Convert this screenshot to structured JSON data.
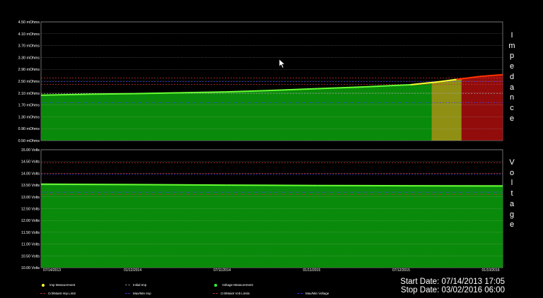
{
  "chart_data": [
    {
      "type": "area",
      "ylabel": "Impedance",
      "ylim": [
        0.5,
        4.5
      ],
      "yticks": [
        "4.50 mOhms",
        "4.10 mOhms",
        "3.70 mOhms",
        "3.30 mOhms",
        "2.90 mOhms",
        "2.50 mOhms",
        "2.10 mOhms",
        "1.70 mOhms",
        "1.30 mOhms",
        "0.90 mOhms",
        "0.50 mOhms"
      ],
      "ytick_values": [
        4.5,
        4.1,
        3.7,
        3.3,
        2.9,
        2.5,
        2.1,
        1.7,
        1.3,
        0.9,
        0.5
      ],
      "series": [
        {
          "name": "Imp Measurement",
          "x": [
            0,
            0.1,
            0.2,
            0.3,
            0.4,
            0.5,
            0.6,
            0.7,
            0.8,
            0.85,
            0.9,
            0.95,
            1.0
          ],
          "values": [
            2.03,
            2.06,
            2.08,
            2.11,
            2.14,
            2.19,
            2.25,
            2.31,
            2.38,
            2.46,
            2.56,
            2.66,
            2.72
          ]
        },
        {
          "name": "Initial Imp",
          "value": 2.09
        },
        {
          "name": "Crit/Maint Imp Limit",
          "values": [
            2.61,
            2.39
          ]
        },
        {
          "name": "Max/Min Imp",
          "values": [
            2.49,
            1.78
          ]
        }
      ],
      "zones": [
        {
          "name": "ok",
          "color": "#0a8a0a",
          "from": 0,
          "to": 0.846
        },
        {
          "name": "maintenance",
          "color": "#8f8f14",
          "from": 0.846,
          "to": 0.911
        },
        {
          "name": "critical",
          "color": "#920c0c",
          "from": 0.911,
          "to": 1.0
        }
      ]
    },
    {
      "type": "area",
      "ylabel": "Voltage",
      "ylim": [
        10.0,
        15.0
      ],
      "yticks": [
        "15.00 Volts",
        "14.50 Volts",
        "14.00 Volts",
        "13.50 Volts",
        "13.00 Volts",
        "12.50 Volts",
        "12.00 Volts",
        "11.50 Volts",
        "11.00 Volts",
        "10.50 Volts",
        "10.00 Volts"
      ],
      "ytick_values": [
        15,
        14.5,
        14,
        13.5,
        13,
        12.5,
        12,
        11.5,
        11,
        10.5,
        10
      ],
      "series": [
        {
          "name": "Voltage Measurement",
          "x": [
            0,
            0.2,
            0.4,
            0.6,
            0.8,
            1.0
          ],
          "values": [
            13.54,
            13.52,
            13.5,
            13.48,
            13.47,
            13.46
          ]
        },
        {
          "name": "Crit/Maint Volt Limits",
          "values": [
            14.45,
            14.0,
            13.1
          ]
        },
        {
          "name": "Max/Min Voltage",
          "values": [
            13.95,
            13.2
          ]
        }
      ]
    }
  ],
  "x_tick_labels": [
    "07/14/2013",
    "01/12/2014",
    "07/11/2014",
    "01/11/2015",
    "07/12/2015",
    "01/10/2016"
  ],
  "side_labels": {
    "impedance": [
      "I",
      "m",
      "p",
      "e",
      "d",
      "a",
      "n",
      "c",
      "e"
    ],
    "voltage": [
      "V",
      "o",
      "l",
      "t",
      "a",
      "g",
      "e"
    ]
  },
  "legend": [
    {
      "label": "Imp Measurement",
      "color": "#ffff33",
      "style": "dot"
    },
    {
      "label": "Initial Imp",
      "color": "#888888",
      "style": "dash"
    },
    {
      "label": "Voltage Measurement",
      "color": "#33ff33",
      "style": "dot"
    },
    {
      "label": "Crit/Maint Imp Limit",
      "color": "#cc3333",
      "style": "dash"
    },
    {
      "label": "Max/Min Imp",
      "color": "#3333ff",
      "style": "dash"
    },
    {
      "label": "Crit/Maint Volt Limits",
      "color": "#cc3333",
      "style": "dash"
    },
    {
      "label": "Max/Min Voltage",
      "color": "#3333ff",
      "style": "dash"
    }
  ],
  "start_date": "Start Date: 07/14/2013 17:05",
  "stop_date": "Stop Date: 03/02/2016 06:00",
  "colors": {
    "green": "#0a8a0a",
    "line": "#66ff33",
    "yellow_line": "#ffff33",
    "red_line": "#ff3300"
  }
}
